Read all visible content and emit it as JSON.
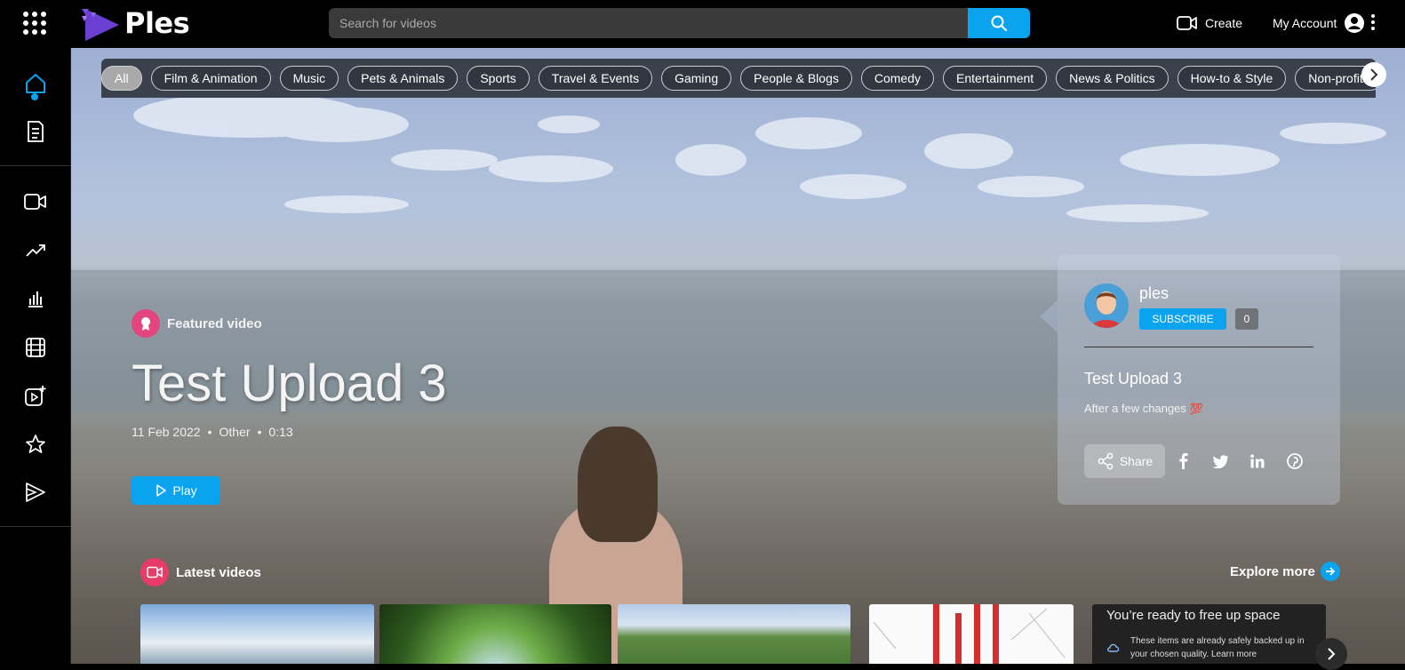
{
  "header": {
    "logo_text": "Ples",
    "search_placeholder": "Search for videos",
    "create_label": "Create",
    "account_label": "My Account"
  },
  "sidebar": {
    "items": [
      {
        "name": "home",
        "icon": "home-icon",
        "active": true
      },
      {
        "name": "subscriptions",
        "icon": "document-list-icon"
      },
      {
        "name": "videos",
        "icon": "video-camera-icon"
      },
      {
        "name": "trending",
        "icon": "trending-icon"
      },
      {
        "name": "stats",
        "icon": "bar-chart-icon"
      },
      {
        "name": "films",
        "icon": "film-icon"
      },
      {
        "name": "upload",
        "icon": "add-video-icon"
      },
      {
        "name": "favorites",
        "icon": "star-icon"
      },
      {
        "name": "playlists",
        "icon": "playlist-play-icon"
      }
    ]
  },
  "categories": [
    "All",
    "Film & Animation",
    "Music",
    "Pets & Animals",
    "Sports",
    "Travel & Events",
    "Gaming",
    "People & Blogs",
    "Comedy",
    "Entertainment",
    "News & Politics",
    "How-to & Style",
    "Non-profits"
  ],
  "featured": {
    "tag": "Featured video",
    "title": "Test Upload 3",
    "date": "11 Feb 2022",
    "category": "Other",
    "duration": "0:13",
    "play_label": "Play"
  },
  "card": {
    "channel": "ples",
    "subscribe_label": "SUBSCRIBE",
    "subscriber_count": "0",
    "title": "Test Upload 3",
    "description": "After a few changes",
    "description_emoji": "💯",
    "share_label": "Share",
    "socials": [
      "facebook-icon",
      "twitter-icon",
      "linkedin-icon",
      "pinterest-icon"
    ]
  },
  "latest": {
    "title": "Latest videos",
    "explore_label": "Explore more",
    "thumb5_heading": "You’re ready to free up space",
    "thumb5_text": "These items are already safely backed up in your chosen quality. Learn more"
  },
  "colors": {
    "accent": "#0aa3ef",
    "pink": "#e3467c",
    "red": "#e83b68"
  }
}
